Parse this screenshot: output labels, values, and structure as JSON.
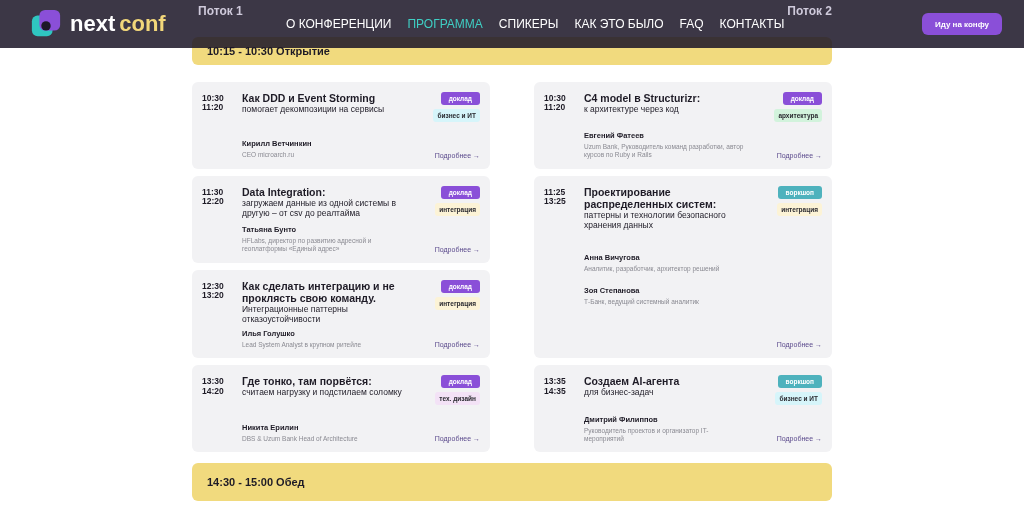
{
  "header": {
    "logo": {
      "part_1": "next",
      "part_2": "conf"
    },
    "nav": [
      {
        "label": "О КОНФЕРЕНЦИИ",
        "selected": false
      },
      {
        "label": "ПРОГРАММА",
        "selected": true
      },
      {
        "label": "СПИКЕРЫ",
        "selected": false
      },
      {
        "label": "КАК ЭТО БЫЛО",
        "selected": false
      },
      {
        "label": "FAQ",
        "selected": false
      },
      {
        "label": "КОНТАКТЫ",
        "selected": false
      }
    ],
    "button": "Иду на конфу"
  },
  "streams": [
    "Поток 1",
    "Поток 2"
  ],
  "opening": "10:15 - 10:30 Открытие",
  "columns": [
    {
      "talks": [
        {
          "start": "10:30",
          "end": "11:20",
          "title": "Как DDD и Event Storming",
          "subtitle": "помогает декомпозиции на сервисы",
          "format": {
            "label": "доклад",
            "color": "#8a4fd8"
          },
          "topic": {
            "label": "бизнес и ИТ",
            "color": "#d6f5fa"
          },
          "speakers": [
            {
              "name": "Кирилл Ветчинкин",
              "role": "CEO microarch.ru"
            }
          ],
          "more": "Подробнее →"
        },
        {
          "start": "11:30",
          "end": "12:20",
          "title": "Data Integration:",
          "subtitle": "загружаем данные из одной системы в другую – от csv до реалтайма",
          "format": {
            "label": "доклад",
            "color": "#8a4fd8"
          },
          "topic": {
            "label": "интеграция",
            "color": "#fcf3d6"
          },
          "speakers": [
            {
              "name": "Татьяна Бунто",
              "role": "HFLabs, директор по развитию адресной и геоплатформы «Единый адрес»"
            }
          ],
          "more": "Подробнее →"
        },
        {
          "start": "12:30",
          "end": "13:20",
          "title": "Как сделать интеграцию и не проклясть свою команду.",
          "subtitle": "Интеграционные паттерны отказоустойчивости",
          "format": {
            "label": "доклад",
            "color": "#8a4fd8"
          },
          "topic": {
            "label": "интеграция",
            "color": "#fcf3d6"
          },
          "speakers": [
            {
              "name": "Илья Голушко",
              "role": "Lead System Analyst в крупном ритейле"
            }
          ],
          "more": "Подробнее →"
        },
        {
          "start": "13:30",
          "end": "14:20",
          "title": "Где тонко, там порвётся:",
          "subtitle": "считаем нагрузку и подстилаем соломку",
          "format": {
            "label": "доклад",
            "color": "#8a4fd8"
          },
          "topic": {
            "label": "тех. дизайн",
            "color": "#f3e2f6"
          },
          "speakers": [
            {
              "name": "Никита Ерилин",
              "role": "DBS & Uzum Bank Head of Architecture"
            }
          ],
          "more": "Подробнее →"
        }
      ]
    },
    {
      "talks": [
        {
          "start": "10:30",
          "end": "11:20",
          "title": "C4 model в Structurizr:",
          "subtitle": "к архитектуре через код",
          "format": {
            "label": "доклад",
            "color": "#8a4fd8"
          },
          "topic": {
            "label": "архитектура",
            "color": "#d2f3dc"
          },
          "speakers": [
            {
              "name": "Евгений Фатеев",
              "role": "Uzum Bank, Руководитель команд разработки, автор курсов по Ruby и Rails"
            }
          ],
          "more": "Подробнее →"
        },
        {
          "start": "11:25",
          "end": "13:25",
          "title": "Проектирование распределенных систем:",
          "subtitle": "паттерны и технологии безопасного хранения данных",
          "format": {
            "label": "воркшоп",
            "color": "#4eb2bd"
          },
          "topic": {
            "label": "интеграция",
            "color": "#fcf3d6"
          },
          "speakers": [
            {
              "name": "Анна Вичугова",
              "role": "Аналитик, разработчик, архитектор решений"
            },
            {
              "name": "Зоя Степанова",
              "role": "Т-Банк, ведущий системный аналитик"
            }
          ],
          "more": "Подробнее →"
        },
        {
          "start": "13:35",
          "end": "14:35",
          "title": "Создаем AI-агента",
          "subtitle": "для бизнес-задач",
          "format": {
            "label": "воркшоп",
            "color": "#4eb2bd"
          },
          "topic": {
            "label": "бизнес и ИТ",
            "color": "#d6f5fa"
          },
          "speakers": [
            {
              "name": "Дмитрий Филиппов",
              "role": "Руководитель проектов и организатор IT-мероприятий"
            }
          ],
          "more": "Подробнее →"
        }
      ]
    }
  ],
  "lunch": "14:30 - 15:00 Обед"
}
